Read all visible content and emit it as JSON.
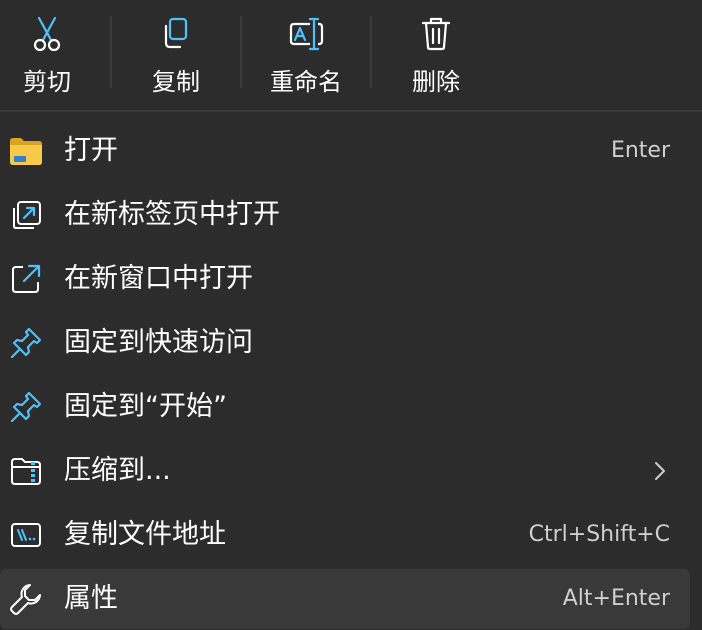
{
  "toolbar": {
    "cut": "剪切",
    "copy": "复制",
    "rename": "重命名",
    "delete": "删除"
  },
  "items": [
    {
      "label": "打开",
      "shortcut": "Enter",
      "icon": "folder-icon"
    },
    {
      "label": "在新标签页中打开",
      "shortcut": "",
      "icon": "new-tab-icon"
    },
    {
      "label": "在新窗口中打开",
      "shortcut": "",
      "icon": "open-external-icon"
    },
    {
      "label": "固定到快速访问",
      "shortcut": "",
      "icon": "pin-icon"
    },
    {
      "label": "固定到“开始”",
      "shortcut": "",
      "icon": "pin-icon"
    },
    {
      "label": "压缩到...",
      "shortcut": "",
      "icon": "zip-folder-icon",
      "submenu": true
    },
    {
      "label": "复制文件地址",
      "shortcut": "Ctrl+Shift+C",
      "icon": "copy-path-icon"
    },
    {
      "label": "属性",
      "shortcut": "Alt+Enter",
      "icon": "wrench-icon"
    }
  ],
  "colors": {
    "background": "#2c2c2c",
    "accent": "#4cc2ff",
    "folder_yellow": "#f7c948",
    "text": "#ffffff",
    "shortcut_text": "#cfcfcf",
    "hover": "#393939"
  }
}
